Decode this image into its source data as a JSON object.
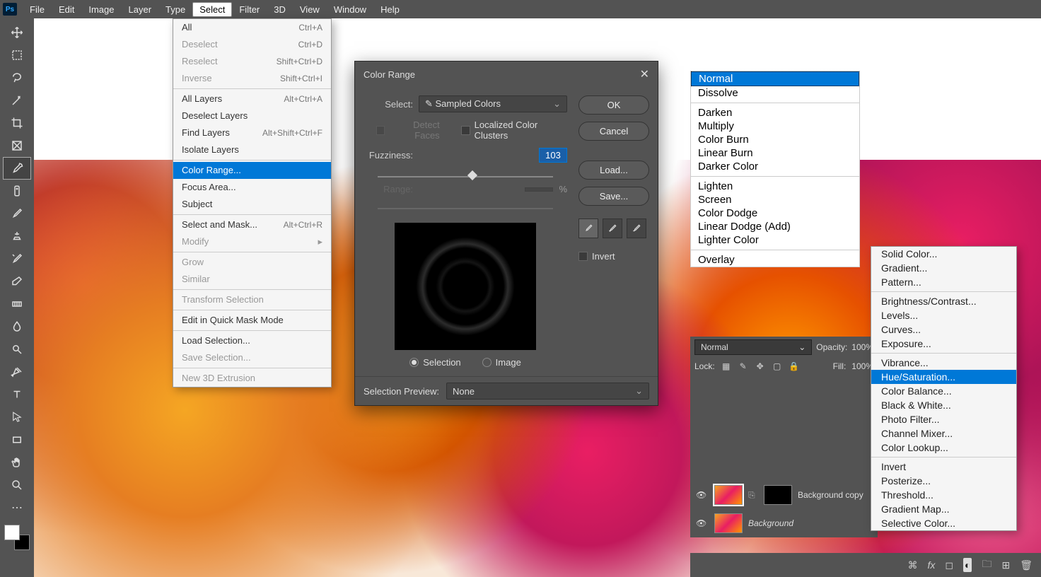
{
  "menubar": [
    "File",
    "Edit",
    "Image",
    "Layer",
    "Type",
    "Select",
    "Filter",
    "3D",
    "View",
    "Window",
    "Help"
  ],
  "menubar_selected": "Select",
  "select_menu": {
    "groups": [
      [
        {
          "label": "All",
          "shortcut": "Ctrl+A"
        },
        {
          "label": "Deselect",
          "shortcut": "Ctrl+D",
          "disabled": true
        },
        {
          "label": "Reselect",
          "shortcut": "Shift+Ctrl+D",
          "disabled": true
        },
        {
          "label": "Inverse",
          "shortcut": "Shift+Ctrl+I",
          "disabled": true
        }
      ],
      [
        {
          "label": "All Layers",
          "shortcut": "Alt+Ctrl+A"
        },
        {
          "label": "Deselect Layers"
        },
        {
          "label": "Find Layers",
          "shortcut": "Alt+Shift+Ctrl+F"
        },
        {
          "label": "Isolate Layers"
        }
      ],
      [
        {
          "label": "Color Range...",
          "highlighted": true
        },
        {
          "label": "Focus Area..."
        },
        {
          "label": "Subject"
        }
      ],
      [
        {
          "label": "Select and Mask...",
          "shortcut": "Alt+Ctrl+R"
        },
        {
          "label": "Modify",
          "submenu": true,
          "disabled": true
        }
      ],
      [
        {
          "label": "Grow",
          "disabled": true
        },
        {
          "label": "Similar",
          "disabled": true
        }
      ],
      [
        {
          "label": "Transform Selection",
          "disabled": true
        }
      ],
      [
        {
          "label": "Edit in Quick Mask Mode"
        }
      ],
      [
        {
          "label": "Load Selection..."
        },
        {
          "label": "Save Selection...",
          "disabled": true
        }
      ],
      [
        {
          "label": "New 3D Extrusion",
          "disabled": true
        }
      ]
    ]
  },
  "color_range": {
    "title": "Color Range",
    "select_label": "Select:",
    "select_value": "Sampled Colors",
    "detect_faces": "Detect Faces",
    "localized": "Localized Color Clusters",
    "fuzziness_label": "Fuzziness:",
    "fuzziness_value": "103",
    "range_label": "Range:",
    "range_unit": "%",
    "selection_label": "Selection",
    "image_label": "Image",
    "selection_preview_label": "Selection Preview:",
    "selection_preview_value": "None",
    "ok": "OK",
    "cancel": "Cancel",
    "load": "Load...",
    "save": "Save...",
    "invert": "Invert"
  },
  "blend_modes": {
    "groups": [
      [
        "Normal",
        "Dissolve"
      ],
      [
        "Darken",
        "Multiply",
        "Color Burn",
        "Linear Burn",
        "Darker Color"
      ],
      [
        "Lighten",
        "Screen",
        "Color Dodge",
        "Linear Dodge (Add)",
        "Lighter Color"
      ],
      [
        "Overlay"
      ]
    ],
    "highlighted": "Normal"
  },
  "layers_panel": {
    "mode": "Normal",
    "opacity_label": "Opacity:",
    "opacity_value": "100%",
    "lock_label": "Lock:",
    "fill_label": "Fill:",
    "fill_value": "100%",
    "layers": [
      {
        "name": "Background copy",
        "mask": true
      },
      {
        "name": "Background",
        "italic": true
      }
    ]
  },
  "adj_menu": {
    "groups": [
      [
        "Solid Color...",
        "Gradient...",
        "Pattern..."
      ],
      [
        "Brightness/Contrast...",
        "Levels...",
        "Curves...",
        "Exposure..."
      ],
      [
        "Vibrance...",
        "Hue/Saturation...",
        "Color Balance...",
        "Black & White...",
        "Photo Filter...",
        "Channel Mixer...",
        "Color Lookup..."
      ],
      [
        "Invert",
        "Posterize...",
        "Threshold...",
        "Gradient Map...",
        "Selective Color..."
      ]
    ],
    "highlighted": "Hue/Saturation..."
  }
}
